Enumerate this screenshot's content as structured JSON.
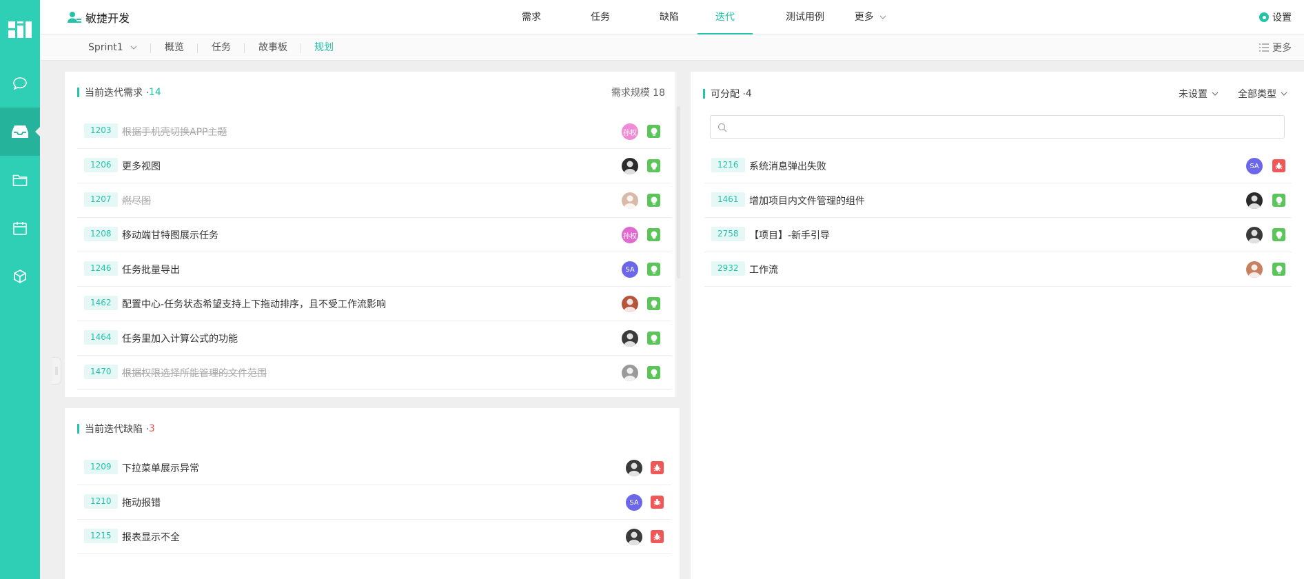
{
  "brand": {
    "name": "敏捷开发",
    "icon": "agile-user-icon"
  },
  "main_tabs": [
    {
      "label": "需求"
    },
    {
      "label": "任务"
    },
    {
      "label": "缺陷"
    },
    {
      "label": "迭代",
      "active": true
    },
    {
      "label": "测试用例"
    },
    {
      "label": "更多"
    }
  ],
  "settings_label": "设置",
  "sub_tabs": {
    "sprint": "Sprint1",
    "items": [
      "概览",
      "任务",
      "故事板",
      "规划"
    ],
    "active": "规划",
    "more": "更多"
  },
  "sidebar_icons": [
    "dashboard-icon",
    "chat-icon",
    "inbox-icon",
    "folder-icon",
    "calendar-icon",
    "cube-icon"
  ],
  "requirements_panel": {
    "title": "当前迭代需求 · ",
    "count": "14",
    "scale_label": "需求规模 18",
    "items": [
      {
        "id": "1203",
        "title": "根据手机壳切换APP主题",
        "done": true,
        "avatar": "孙权",
        "avatar_color": "#f08bd6",
        "badge": "green"
      },
      {
        "id": "1206",
        "title": "更多视图",
        "done": false,
        "avatar": "",
        "avatar_color": "#2b2b2b",
        "badge": "green"
      },
      {
        "id": "1207",
        "title": "燃尽图",
        "done": true,
        "avatar": "",
        "avatar_color": "#d9b9a8",
        "badge": "green"
      },
      {
        "id": "1208",
        "title": "移动端甘特图展示任务",
        "done": false,
        "avatar": "孙权",
        "avatar_color": "#e06ad0",
        "badge": "green"
      },
      {
        "id": "1246",
        "title": "任务批量导出",
        "done": false,
        "avatar": "SA",
        "avatar_color": "#6c66e8",
        "badge": "green"
      },
      {
        "id": "1462",
        "title": "配置中心-任务状态希望支持上下拖动排序，且不受工作流影响",
        "done": false,
        "avatar": "",
        "avatar_color": "#b5553a",
        "badge": "green"
      },
      {
        "id": "1464",
        "title": "任务里加入计算公式的功能",
        "done": false,
        "avatar": "",
        "avatar_color": "#3a3a3a",
        "badge": "green"
      },
      {
        "id": "1470",
        "title": "根据权限选择所能管理的文件范围",
        "done": true,
        "avatar": "",
        "avatar_color": "#9a9a9a",
        "badge": "green"
      }
    ]
  },
  "bugs_panel": {
    "title": "当前迭代缺陷 · ",
    "count": "3",
    "items": [
      {
        "id": "1209",
        "title": "下拉菜单展示异常",
        "avatar": "",
        "avatar_color": "#3a3a3a",
        "badge": "red"
      },
      {
        "id": "1210",
        "title": "拖动报错",
        "avatar": "SA",
        "avatar_color": "#6c66e8",
        "badge": "red"
      },
      {
        "id": "1215",
        "title": "报表显示不全",
        "avatar": "",
        "avatar_color": "#3a3a3a",
        "badge": "red"
      }
    ]
  },
  "assignable_panel": {
    "title": "可分配 · ",
    "count": "4",
    "filter_status": "未设置",
    "filter_type": "全部类型",
    "search_placeholder": "",
    "items": [
      {
        "id": "1216",
        "title": "系统消息弹出失败",
        "avatar": "SA",
        "avatar_color": "#6c66e8",
        "badge": "red"
      },
      {
        "id": "1461",
        "title": "增加项目内文件管理的组件",
        "avatar": "",
        "avatar_color": "#2b2b2b",
        "badge": "green"
      },
      {
        "id": "2758",
        "title": "【项目】-新手引导",
        "avatar": "",
        "avatar_color": "#3a3a3a",
        "badge": "green"
      },
      {
        "id": "2932",
        "title": "工作流",
        "avatar": "",
        "avatar_color": "#c8815f",
        "badge": "green"
      }
    ]
  }
}
